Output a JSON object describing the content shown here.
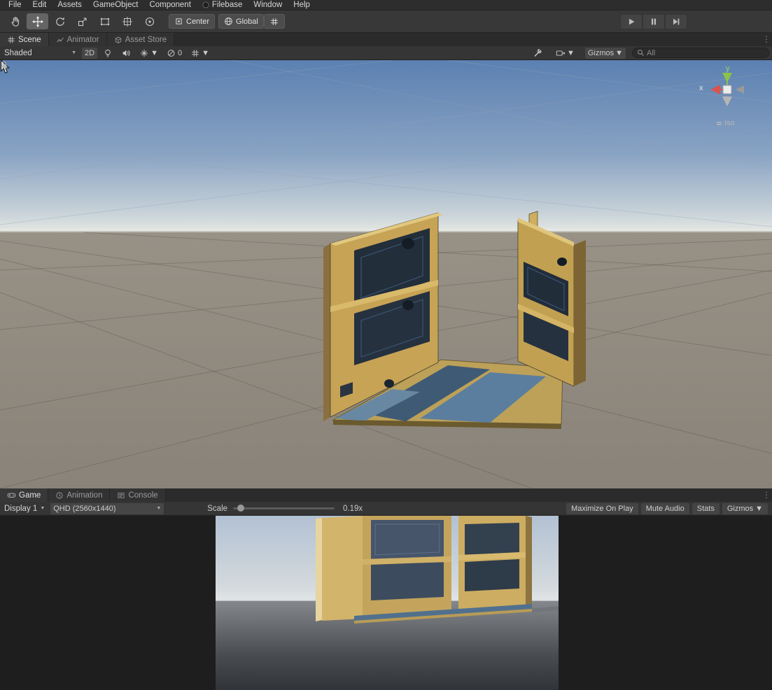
{
  "menu_bar": {
    "items": [
      "File",
      "Edit",
      "Assets",
      "GameObject",
      "Component",
      "Filebase",
      "Window",
      "Help"
    ]
  },
  "toolbar": {
    "pivot_label": "Center",
    "space_label": "Global"
  },
  "scene_panel": {
    "tabs": [
      {
        "label": "Scene"
      },
      {
        "label": "Animator"
      },
      {
        "label": "Asset Store"
      }
    ],
    "toolbar": {
      "draw_mode": "Shaded",
      "mode_2d": "2D",
      "hidden_count": "0",
      "gizmos_label": "Gizmos",
      "search_placeholder": "All"
    },
    "gizmo": {
      "x": "x",
      "y": "y",
      "projection": "Iso"
    }
  },
  "game_panel": {
    "tabs": [
      {
        "label": "Game"
      },
      {
        "label": "Animation"
      },
      {
        "label": "Console"
      }
    ],
    "toolbar": {
      "display": "Display 1",
      "resolution": "QHD (2560x1440)",
      "scale_label": "Scale",
      "scale_value": "0.19x",
      "maximize": "Maximize On Play",
      "mute": "Mute Audio",
      "stats": "Stats",
      "gizmos": "Gizmos"
    }
  },
  "colors": {
    "structure_tan": "#c7a356",
    "panel_navy": "#232e3b",
    "floor_blue": "#51708e",
    "axis_y_green": "#8bc34a",
    "axis_x_red": "#d9534f"
  }
}
